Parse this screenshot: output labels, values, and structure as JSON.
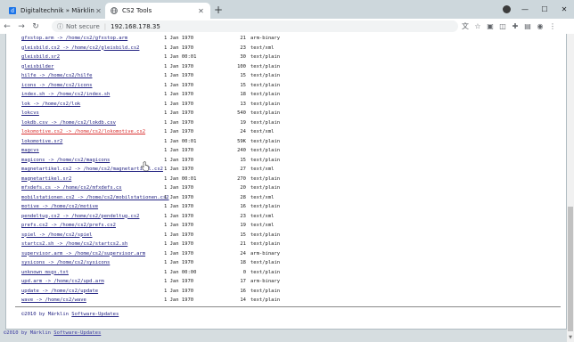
{
  "tabs": [
    {
      "title": "Digitaltechnik » Märklin UID Hov"
    },
    {
      "title": "CS2 Tools"
    }
  ],
  "toolbar": {
    "security": "Not secure",
    "url": "192.168.178.35"
  },
  "listing": {
    "rows": [
      {
        "name": "gfxstop.arm -> /home/cs2/gfxstop.arm",
        "date": "1 Jan 1970",
        "size": "21",
        "type": "arm-binary"
      },
      {
        "name": "gleisbild.cs2 -> /home/cs2/gleisbild.cs2",
        "date": "1 Jan 1970",
        "size": "23",
        "type": "text/xml"
      },
      {
        "name": "gleisbild.sr2",
        "date": "1 Jan 00:01",
        "size": "30",
        "type": "text/plain"
      },
      {
        "name": "gleisbilder",
        "date": "1 Jan 1970",
        "size": "100",
        "type": "text/plain"
      },
      {
        "name": "hilfe -> /home/cs2/hilfe",
        "date": "1 Jan 1970",
        "size": "15",
        "type": "text/plain"
      },
      {
        "name": "icons -> /home/cs2/icons",
        "date": "1 Jan 1970",
        "size": "15",
        "type": "text/plain"
      },
      {
        "name": "index.sh -> /home/cs2/index.sh",
        "date": "1 Jan 1970",
        "size": "18",
        "type": "text/plain"
      },
      {
        "name": "lok -> /home/cs2/lok",
        "date": "1 Jan 1970",
        "size": "13",
        "type": "text/plain"
      },
      {
        "name": "lokcvs",
        "date": "1 Jan 1970",
        "size": "540",
        "type": "text/plain"
      },
      {
        "name": "lokdb.csv -> /home/cs2/lokdb.csv",
        "date": "1 Jan 1970",
        "size": "19",
        "type": "text/plain"
      },
      {
        "name": "lokomotive.cs2 -> /home/cs2/lokomotive.cs2",
        "date": "1 Jan 1970",
        "size": "24",
        "type": "text/xml"
      },
      {
        "name": "lokomotive.sr2",
        "date": "1 Jan 00:01",
        "size": "59K",
        "type": "text/plain"
      },
      {
        "name": "magcvs",
        "date": "1 Jan 1970",
        "size": "240",
        "type": "text/plain"
      },
      {
        "name": "magicons -> /home/cs2/magicons",
        "date": "1 Jan 1970",
        "size": "15",
        "type": "text/plain"
      },
      {
        "name": "magnetartikel.cs2 -> /home/cs2/magnetartikel.cs2",
        "date": "1 Jan 1970",
        "size": "27",
        "type": "text/xml"
      },
      {
        "name": "magnetartikel.sr2",
        "date": "1 Jan 00:01",
        "size": "270",
        "type": "text/plain"
      },
      {
        "name": "mfxdefs.cs -> /home/cs2/mfxdefs.cs",
        "date": "1 Jan 1970",
        "size": "20",
        "type": "text/plain"
      },
      {
        "name": "mobilstationen.cs2 -> /home/cs2/mobilstationen.cs2",
        "date": "1 Jan 1970",
        "size": "28",
        "type": "text/xml"
      },
      {
        "name": "motive -> /home/cs2/motive",
        "date": "1 Jan 1970",
        "size": "16",
        "type": "text/plain"
      },
      {
        "name": "pendeltug.cs2 -> /home/cs2/pendeltug.cs2",
        "date": "1 Jan 1970",
        "size": "23",
        "type": "text/xml"
      },
      {
        "name": "prefs.cs2 -> /home/cs2/prefs.cs2",
        "date": "1 Jan 1970",
        "size": "19",
        "type": "text/xml"
      },
      {
        "name": "spiel -> /home/cs2/spiel",
        "date": "1 Jan 1970",
        "size": "15",
        "type": "text/plain"
      },
      {
        "name": "startcs2.sh -> /home/cs2/startcs2.sh",
        "date": "1 Jan 1970",
        "size": "21",
        "type": "text/plain"
      },
      {
        "name": "supervisor.arm -> /home/cs2/supervisor.arm",
        "date": "1 Jan 1970",
        "size": "24",
        "type": "arm-binary"
      },
      {
        "name": "sysicons -> /home/cs2/sysicons",
        "date": "1 Jan 1970",
        "size": "18",
        "type": "text/plain"
      },
      {
        "name": "unknown_msgs.txt",
        "date": "1 Jan 00:00",
        "size": "0",
        "type": "text/plain"
      },
      {
        "name": "upd.arm -> /home/cs2/upd.arm",
        "date": "1 Jan 1970",
        "size": "17",
        "type": "arm-binary"
      },
      {
        "name": "update -> /home/cs2/update",
        "date": "1 Jan 1970",
        "size": "16",
        "type": "text/plain"
      },
      {
        "name": "wave -> /home/cs2/wave",
        "date": "1 Jan 1970",
        "size": "14",
        "type": "text/plain"
      }
    ]
  },
  "footer": {
    "copyright": "©2010 by Märklin",
    "link": "Software-Updates"
  },
  "bottom_footer": {
    "copyright": "©2010 by Märklin",
    "link": "Software-Updates"
  }
}
